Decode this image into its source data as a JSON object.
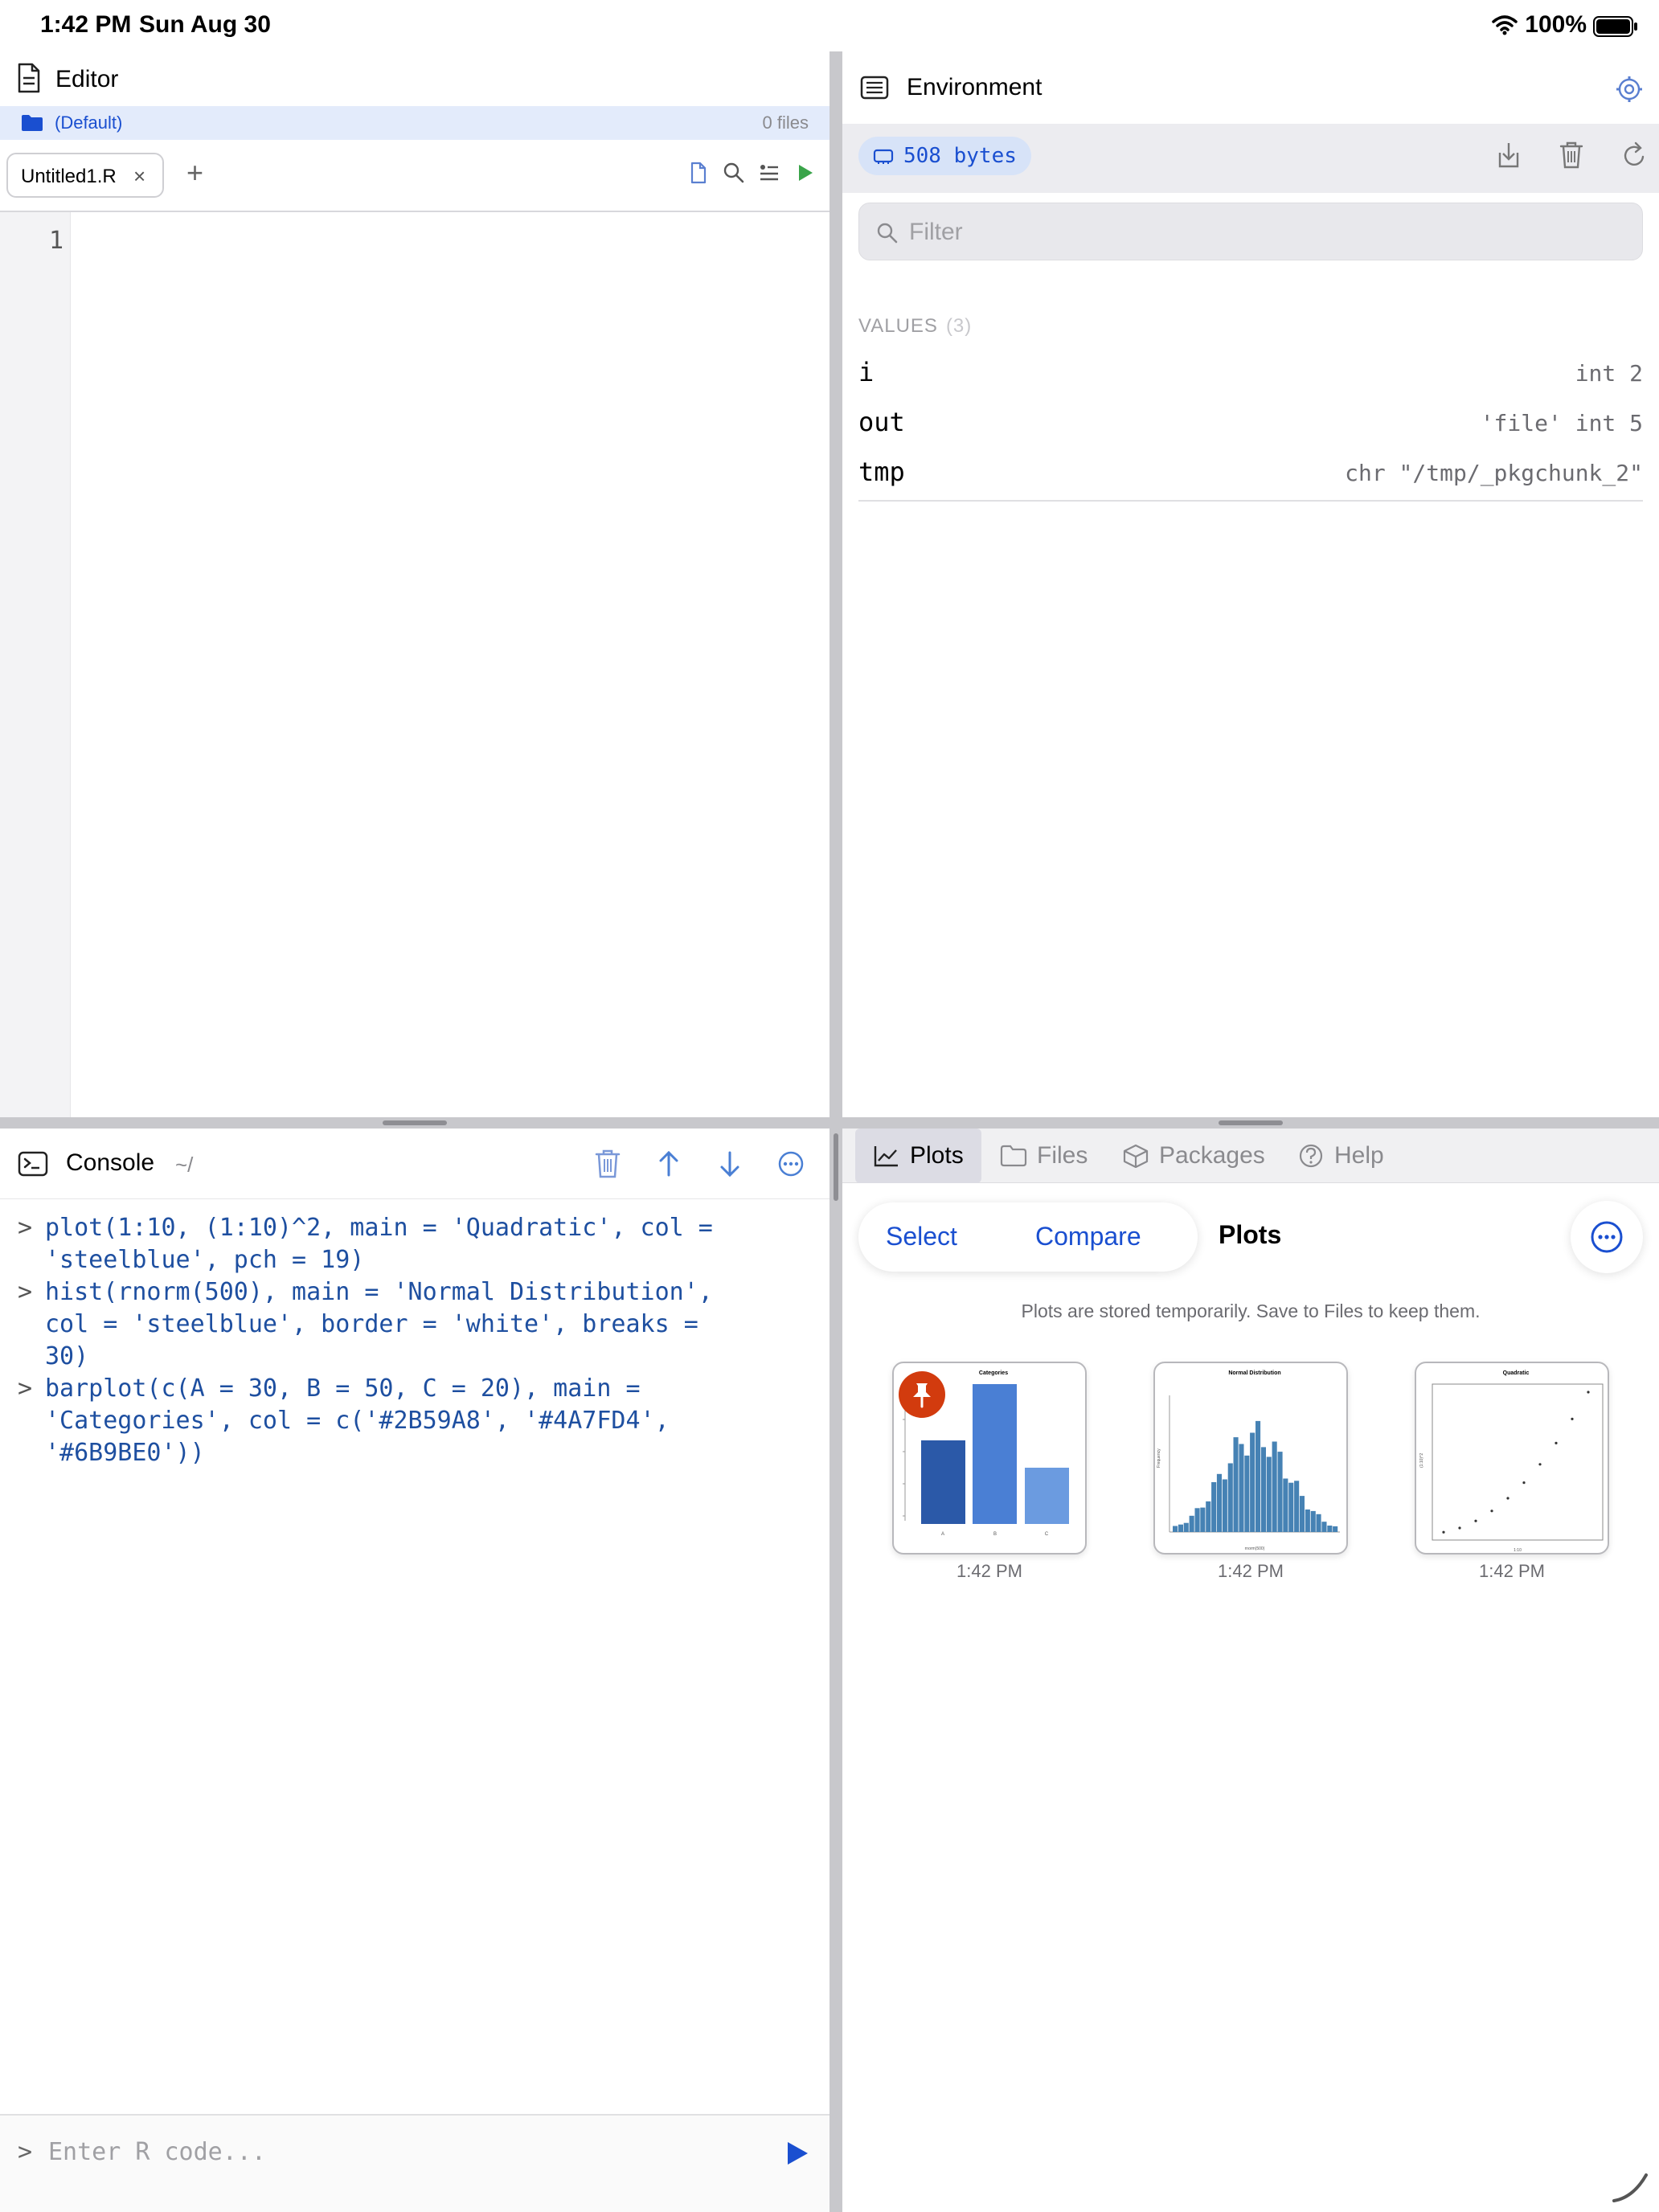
{
  "status_bar": {
    "time": "1:42 PM",
    "date": "Sun Aug 30",
    "battery": "100%"
  },
  "editor": {
    "title": "Editor",
    "project": "(Default)",
    "file_count": "0 files",
    "tab_label": "Untitled1.R",
    "tab_close": "×",
    "add_tab": "+",
    "line_numbers": [
      "1"
    ]
  },
  "console": {
    "title": "Console",
    "path": "~/",
    "prompt": ">",
    "lines": [
      "plot(1:10, (1:10)^2, main = 'Quadratic', col =\n'steelblue', pch = 19)",
      "hist(rnorm(500), main = 'Normal Distribution',\ncol = 'steelblue', border = 'white', breaks =\n30)",
      "barplot(c(A = 30, B = 50, C = 20), main =\n'Categories', col = c('#2B59A8', '#4A7FD4',\n'#6B9BE0'))"
    ],
    "input_placeholder": "Enter R code..."
  },
  "environment": {
    "title": "Environment",
    "memory": "508 bytes",
    "filter_placeholder": "Filter",
    "values_label": "VALUES",
    "values_count": "(3)",
    "variables": [
      {
        "name": "i",
        "value": "int 2"
      },
      {
        "name": "out",
        "value": "'file' int 5"
      },
      {
        "name": "tmp",
        "value": "chr \"/tmp/_pkgchunk_2\""
      }
    ]
  },
  "plots_pane": {
    "tabs": [
      "Plots",
      "Files",
      "Packages",
      "Help"
    ],
    "select_label": "Select",
    "compare_label": "Compare",
    "title": "Plots",
    "note": "Plots are stored temporarily. Save to Files to keep them.",
    "thumbnails": [
      {
        "time": "1:42 PM",
        "pinned": true
      },
      {
        "time": "1:42 PM",
        "pinned": false
      },
      {
        "time": "1:42 PM",
        "pinned": false
      }
    ]
  },
  "colors": {
    "accent": "#1a4fd0",
    "console_code": "#1e4fa0",
    "pin": "#d23b0e",
    "bar_1": "#2B59A8",
    "bar_2": "#4A7FD4",
    "bar_3": "#6B9BE0",
    "steelblue": "#4682B4"
  },
  "icons": {
    "editor": "document-icon",
    "console": "terminal-icon",
    "environment": "list-icon",
    "settings": "gear-icon"
  }
}
